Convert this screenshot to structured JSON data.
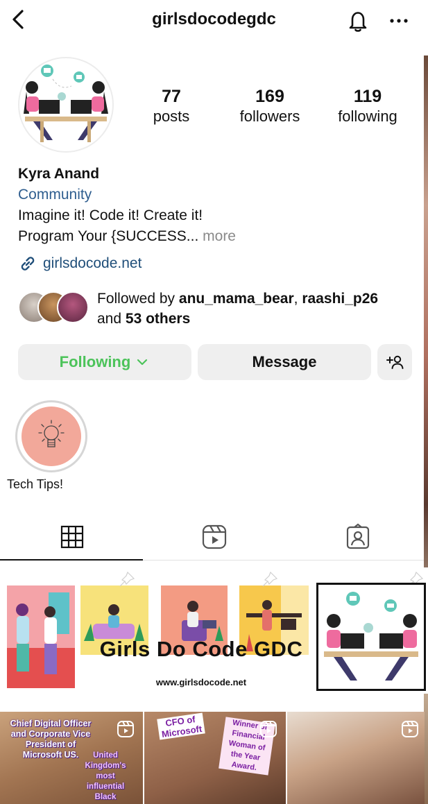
{
  "header": {
    "username": "girlsdocodegdc",
    "back_icon": "chevron-left-icon",
    "bell_icon": "bell-icon",
    "more_icon": "more-horizontal-icon"
  },
  "profile": {
    "posts": {
      "value": "77",
      "label": "posts"
    },
    "followers": {
      "value": "169",
      "label": "followers"
    },
    "following": {
      "value": "119",
      "label": "following"
    },
    "name": "Kyra Anand",
    "category": "Community",
    "bio_line1": "Imagine it! Code it! Create it!",
    "bio_line2": "Program Your {SUCCESS...",
    "more_label": "more",
    "link": "girlsdocode.net"
  },
  "followed_by": {
    "prefix": "Followed by",
    "user1": "anu_mama_bear",
    "separator": ",",
    "user2": "raashi_p26",
    "and_label": "and",
    "others": "53 others"
  },
  "actions": {
    "following_label": "Following",
    "message_label": "Message",
    "add_user_icon": "add-user-icon"
  },
  "highlights": [
    {
      "label": "Tech Tips!"
    }
  ],
  "tabs": [
    {
      "name": "grid",
      "icon": "grid-icon",
      "active": true
    },
    {
      "name": "reels",
      "icon": "reels-icon",
      "active": false
    },
    {
      "name": "tagged",
      "icon": "tagged-icon",
      "active": false
    }
  ],
  "banner": {
    "title": "Girls Do Code GDC",
    "url": "www.girlsdocode.net"
  },
  "posts": [
    {
      "overlay": "Chief Digital Officer and Corporate Vice President of Microsoft US.",
      "overlay2": "United Kingdom's most influential Black person"
    },
    {
      "overlay": "CFO of Microsoft",
      "overlay2": "Winner of Financial Woman of the Year Award."
    },
    {
      "overlay": ""
    }
  ],
  "colors": {
    "following_green": "#4cc35a",
    "link_blue": "#1f4e79",
    "category_blue": "#2f5e8f",
    "button_bg": "#efefef",
    "highlight_peach": "#f2a89a"
  }
}
